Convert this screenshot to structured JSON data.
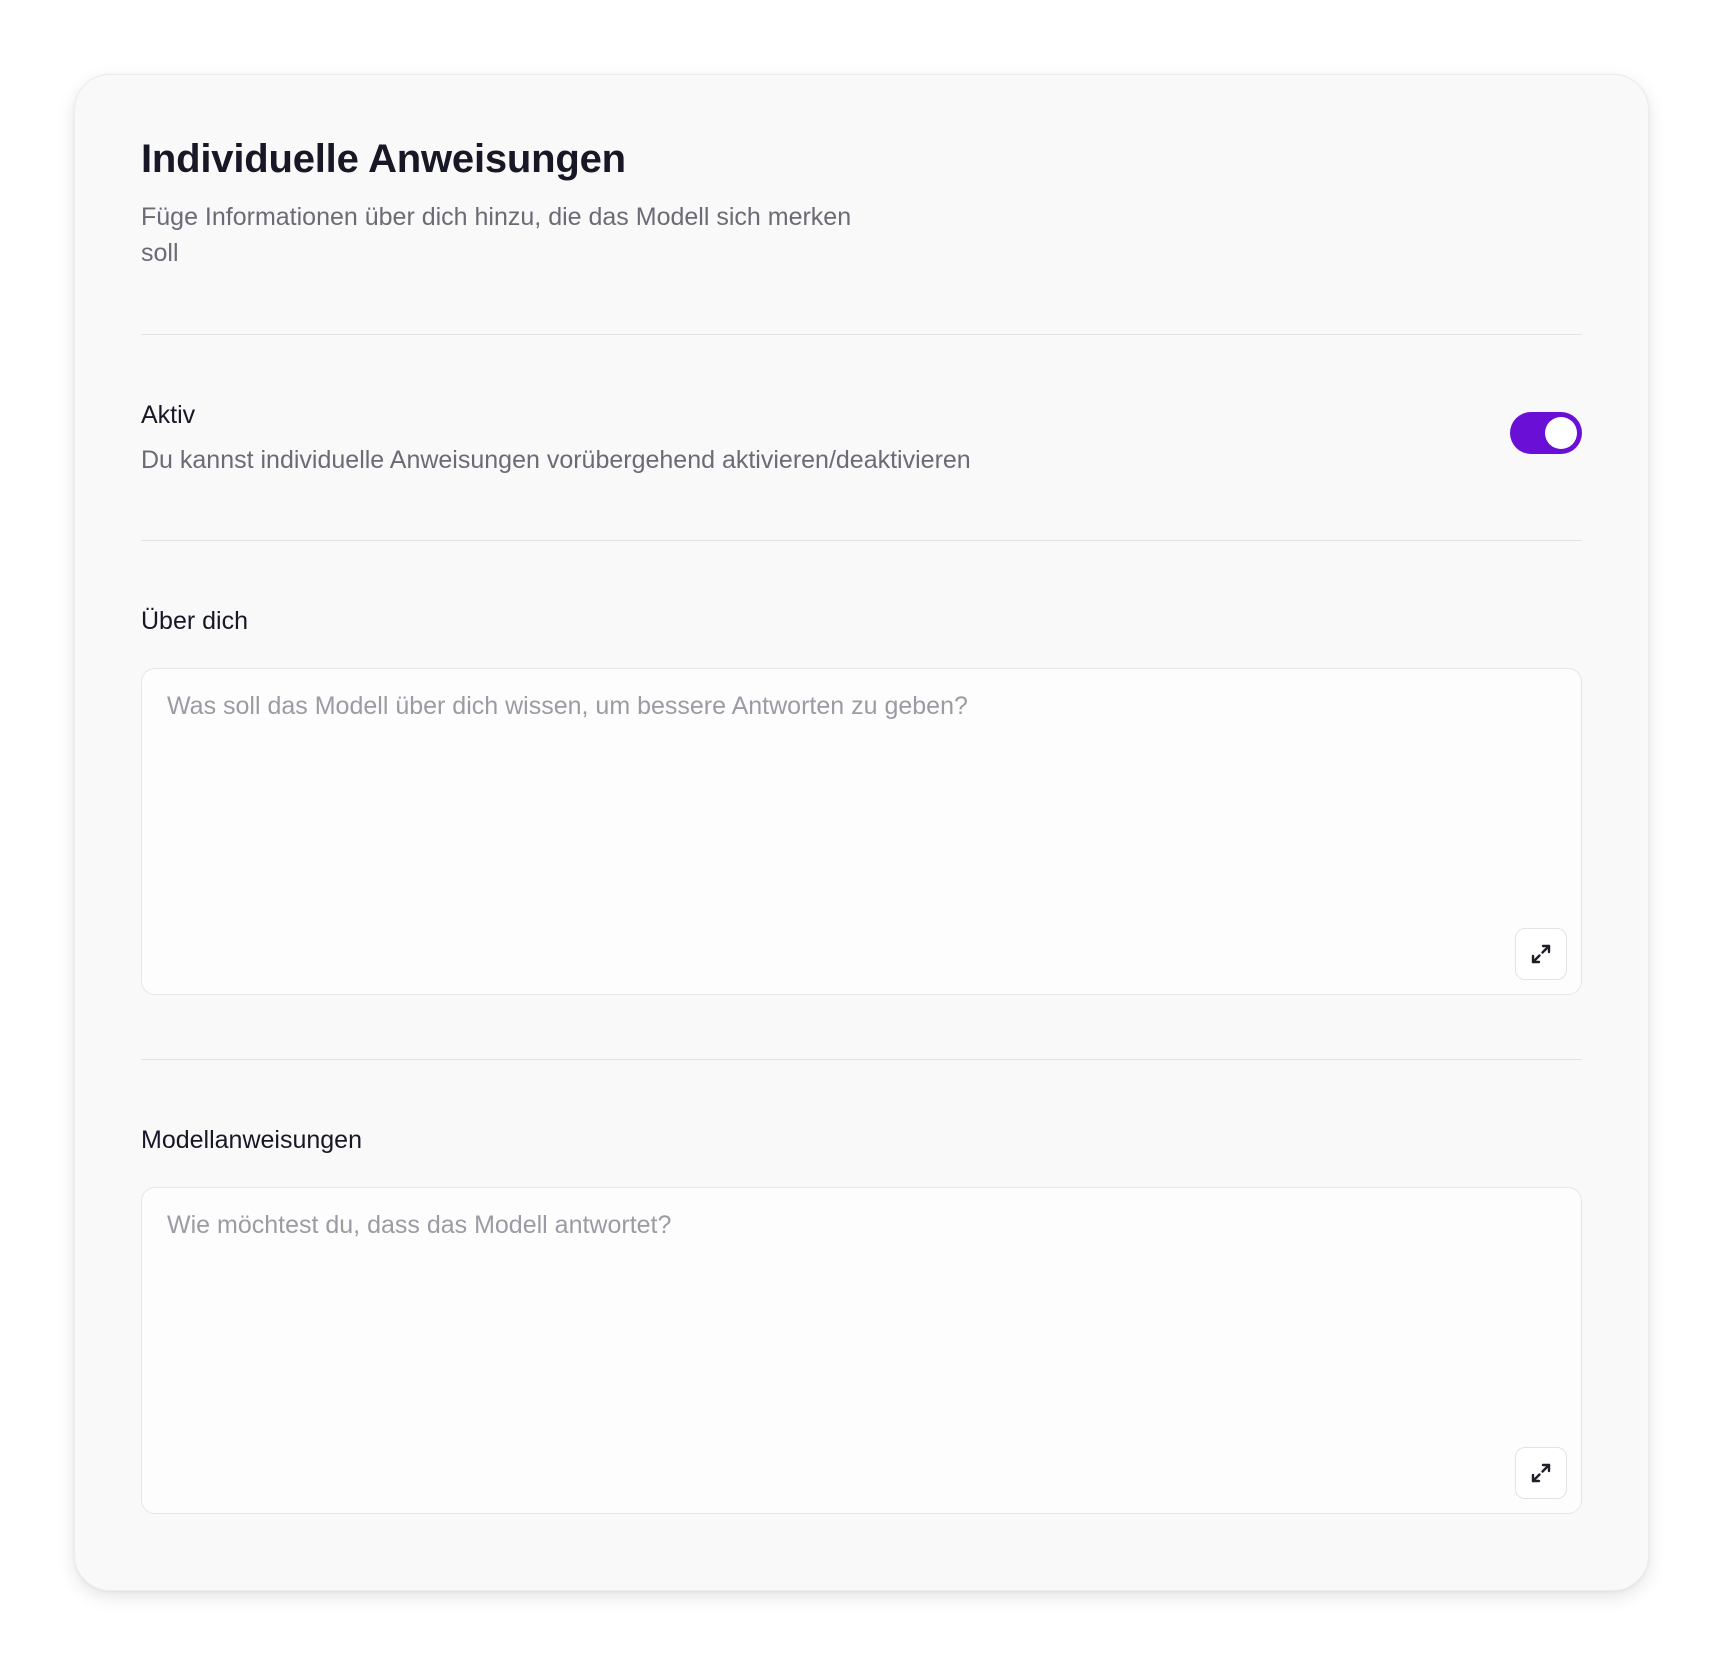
{
  "header": {
    "title": "Individuelle Anweisungen",
    "subtitle": "Füge Informationen über dich hinzu, die das Modell sich merken soll"
  },
  "active": {
    "label": "Aktiv",
    "description": "Du kannst individuelle Anweisungen vorübergehend aktivieren/deaktivieren",
    "enabled": true,
    "toggle_color": "#6a10d6"
  },
  "about": {
    "label": "Über dich",
    "value": "",
    "placeholder": "Was soll das Modell über dich wissen, um bessere Antworten zu geben?",
    "expand_icon": "expand-icon"
  },
  "model_instructions": {
    "label": "Modellanweisungen",
    "value": "",
    "placeholder": "Wie möchtest du, dass das Modell antwortet?",
    "expand_icon": "expand-icon"
  }
}
